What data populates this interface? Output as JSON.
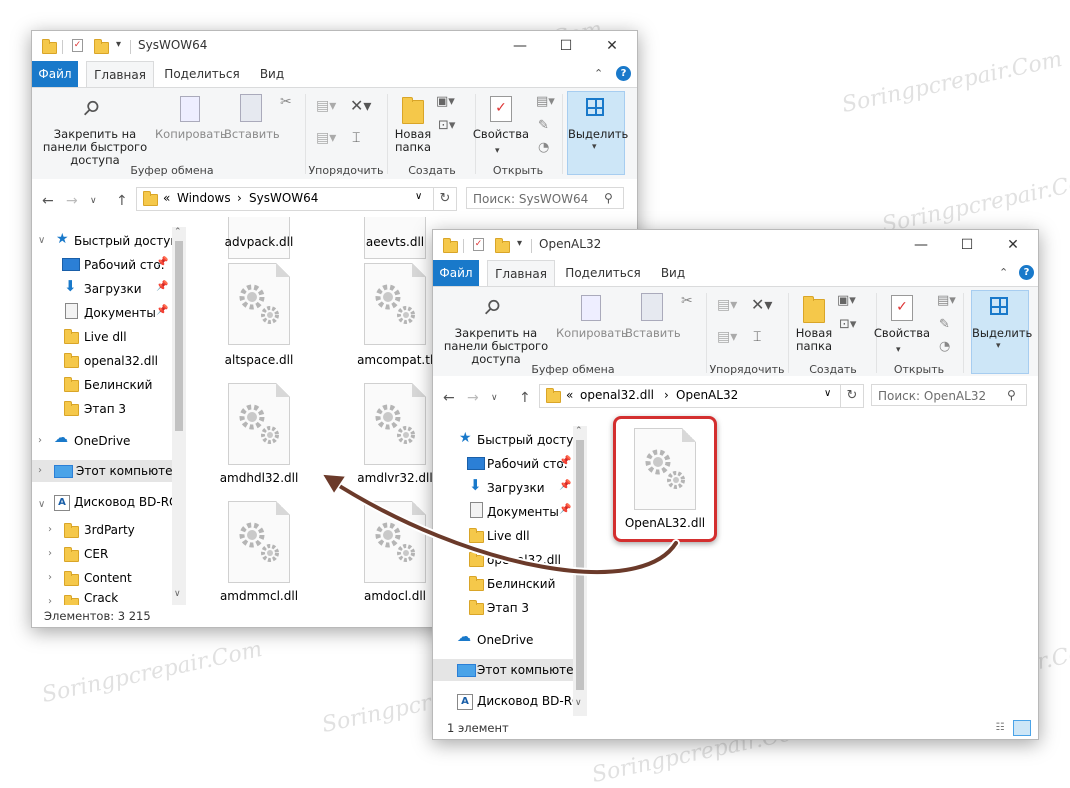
{
  "back_window": {
    "title": "SysWOW64",
    "tabs": [
      "Файл",
      "Главная",
      "Поделиться",
      "Вид"
    ],
    "ribbon": {
      "pin": "Закрепить на панели быстрого доступа",
      "copy": "Копировать",
      "paste": "Вставить",
      "clipboard_group": "Буфер обмена",
      "organize_group": "Упорядочить",
      "new_folder": "Новая папка",
      "create_group": "Создать",
      "properties": "Свойства",
      "open_group": "Открыть",
      "select": "Выделить"
    },
    "breadcrumb": [
      "«",
      "Windows",
      "›",
      "SysWOW64"
    ],
    "search_placeholder": "Поиск: SysWOW64",
    "nav": {
      "quick_access": "Быстрый доступ",
      "desktop": "Рабочий сто.",
      "downloads": "Загрузки",
      "documents": "Документы",
      "live_dll": "Live dll",
      "openal32": "openal32.dll",
      "belinsky": "Белинский",
      "etap3": "Этап 3",
      "onedrive": "OneDrive",
      "this_pc": "Этот компьютер",
      "bd_rom": "Дисковод BD-ROI",
      "thirdparty": "3rdParty",
      "cer": "CER",
      "content": "Content",
      "crack": "Crack"
    },
    "files": [
      "advpack.dll",
      "aeevts.dll",
      "altspace.dll",
      "amcompat.tlb",
      "amdhdl32.dll",
      "amdlvr32.dll",
      "amdmmcl.dll",
      "amdocl.dll"
    ],
    "status": "Элементов: 3 215"
  },
  "front_window": {
    "title": "OpenAL32",
    "tabs": [
      "Файл",
      "Главная",
      "Поделиться",
      "Вид"
    ],
    "ribbon": {
      "pin": "Закрепить на панели быстрого доступа",
      "copy": "Копировать",
      "paste": "Вставить",
      "clipboard_group": "Буфер обмена",
      "organize_group": "Упорядочить",
      "new_folder": "Новая папка",
      "create_group": "Создать",
      "properties": "Свойства",
      "open_group": "Открыть",
      "select": "Выделить"
    },
    "breadcrumb": [
      "«",
      "openal32.dll",
      "›",
      "OpenAL32"
    ],
    "search_placeholder": "Поиск: OpenAL32",
    "nav": {
      "quick_access": "Быстрый доступ",
      "desktop": "Рабочий сто.",
      "downloads": "Загрузки",
      "documents": "Документы",
      "live_dll": "Live dll",
      "openal32": "openal32.dll",
      "belinsky": "Белинский",
      "etap3": "Этап 3",
      "onedrive": "OneDrive",
      "this_pc": "Этот компьютер",
      "bd_rom": "Дисковод BD-ROI"
    },
    "file": "OpenAL32.dll",
    "status": "1 элемент"
  },
  "watermark": "Soringpcrepair.Com",
  "colors": {
    "file_tab": "#1979ca",
    "highlight": "#d32f2f",
    "arrow": "#6b3a2a",
    "folder": "#f5c84a"
  }
}
